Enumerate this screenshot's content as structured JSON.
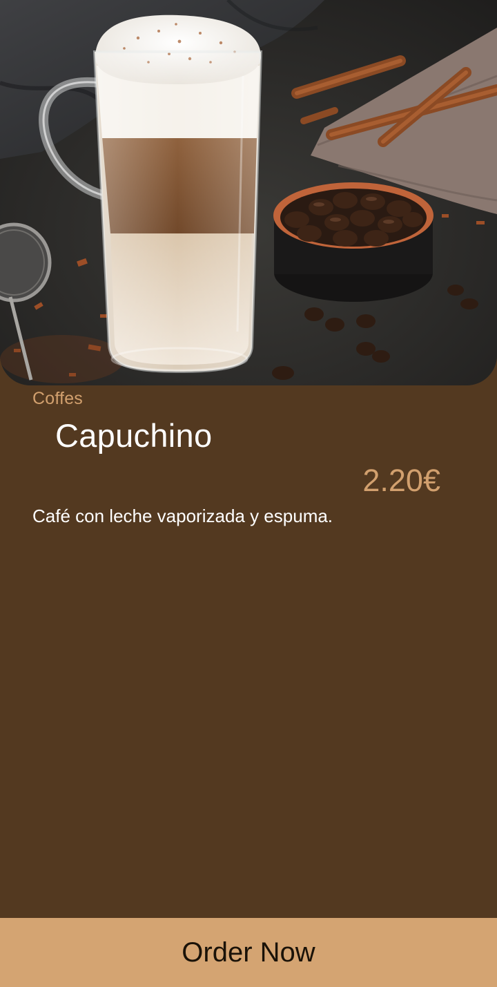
{
  "product": {
    "category": "Coffes",
    "name": "Capuchino",
    "price": "2.20€",
    "description": "Café con leche vaporizada y espuma."
  },
  "actions": {
    "order_label": "Order Now"
  },
  "colors": {
    "background": "#533920",
    "accent": "#d2a06e",
    "button": "#d4a472"
  },
  "hero_image": {
    "icon": "cappuccino-photo"
  }
}
